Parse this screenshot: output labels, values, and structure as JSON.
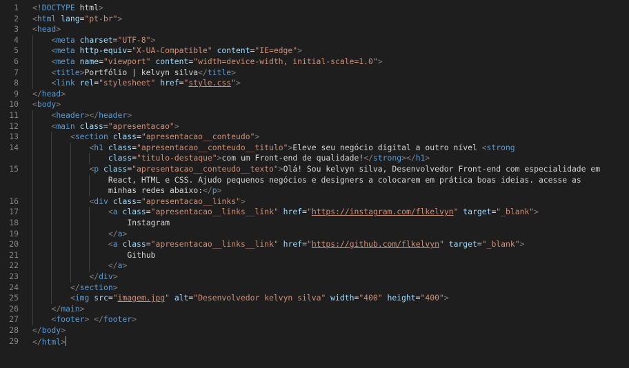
{
  "colors": {
    "background": "#1e1e1e",
    "tag": "#569cd6",
    "bracket": "#808080",
    "attribute": "#9cdcfe",
    "string": "#ce9178",
    "text": "#d4d4d4",
    "line_number": "#858585"
  },
  "active_line": 32,
  "lines": [
    {
      "n": "1",
      "indent": 0,
      "tokens": [
        [
          "br",
          "<!"
        ],
        [
          "doc",
          "DOCTYPE"
        ],
        [
          "text",
          " html"
        ],
        [
          "br",
          ">"
        ]
      ]
    },
    {
      "n": "2",
      "indent": 0,
      "tokens": [
        [
          "br",
          "<"
        ],
        [
          "tag",
          "html"
        ],
        [
          "text",
          " "
        ],
        [
          "attr",
          "lang"
        ],
        [
          "text",
          "="
        ],
        [
          "str",
          "\"pt-br\""
        ],
        [
          "br",
          ">"
        ]
      ]
    },
    {
      "n": "3",
      "indent": 0,
      "tokens": [
        [
          "br",
          "<"
        ],
        [
          "tag",
          "head"
        ],
        [
          "br",
          ">"
        ]
      ]
    },
    {
      "n": "4",
      "indent": 1,
      "tokens": [
        [
          "br",
          "<"
        ],
        [
          "tag",
          "meta"
        ],
        [
          "text",
          " "
        ],
        [
          "attr",
          "charset"
        ],
        [
          "text",
          "="
        ],
        [
          "str",
          "\"UTF-8\""
        ],
        [
          "br",
          ">"
        ]
      ]
    },
    {
      "n": "5",
      "indent": 1,
      "tokens": [
        [
          "br",
          "<"
        ],
        [
          "tag",
          "meta"
        ],
        [
          "text",
          " "
        ],
        [
          "attr",
          "http-equiv"
        ],
        [
          "text",
          "="
        ],
        [
          "str",
          "\"X-UA-Compatible\""
        ],
        [
          "text",
          " "
        ],
        [
          "attr",
          "content"
        ],
        [
          "text",
          "="
        ],
        [
          "str",
          "\"IE=edge\""
        ],
        [
          "br",
          ">"
        ]
      ]
    },
    {
      "n": "6",
      "indent": 1,
      "tokens": [
        [
          "br",
          "<"
        ],
        [
          "tag",
          "meta"
        ],
        [
          "text",
          " "
        ],
        [
          "attr",
          "name"
        ],
        [
          "text",
          "="
        ],
        [
          "str",
          "\"viewport\""
        ],
        [
          "text",
          " "
        ],
        [
          "attr",
          "content"
        ],
        [
          "text",
          "="
        ],
        [
          "str",
          "\"width=device-width, initial-scale=1.0\""
        ],
        [
          "br",
          ">"
        ]
      ]
    },
    {
      "n": "7",
      "indent": 1,
      "tokens": [
        [
          "br",
          "<"
        ],
        [
          "tag",
          "title"
        ],
        [
          "br",
          ">"
        ],
        [
          "text",
          "Portfólio | kelvyn silva"
        ],
        [
          "br",
          "</"
        ],
        [
          "tag",
          "title"
        ],
        [
          "br",
          ">"
        ]
      ]
    },
    {
      "n": "8",
      "indent": 1,
      "tokens": [
        [
          "br",
          "<"
        ],
        [
          "tag",
          "link"
        ],
        [
          "text",
          " "
        ],
        [
          "attr",
          "rel"
        ],
        [
          "text",
          "="
        ],
        [
          "str",
          "\"stylesheet\""
        ],
        [
          "text",
          " "
        ],
        [
          "attr",
          "href"
        ],
        [
          "text",
          "="
        ],
        [
          "str",
          "\""
        ],
        [
          "stru",
          "style.css"
        ],
        [
          "str",
          "\""
        ],
        [
          "br",
          ">"
        ]
      ]
    },
    {
      "n": "9",
      "indent": 0,
      "tokens": [
        [
          "br",
          "</"
        ],
        [
          "tag",
          "head"
        ],
        [
          "br",
          ">"
        ]
      ]
    },
    {
      "n": "10",
      "indent": 0,
      "tokens": [
        [
          "br",
          "<"
        ],
        [
          "tag",
          "body"
        ],
        [
          "br",
          ">"
        ]
      ]
    },
    {
      "n": "11",
      "indent": 1,
      "tokens": [
        [
          "br",
          "<"
        ],
        [
          "tag",
          "header"
        ],
        [
          "br",
          "></"
        ],
        [
          "tag",
          "header"
        ],
        [
          "br",
          ">"
        ]
      ]
    },
    {
      "n": "12",
      "indent": 1,
      "tokens": [
        [
          "br",
          "<"
        ],
        [
          "tag",
          "main"
        ],
        [
          "text",
          " "
        ],
        [
          "attr",
          "class"
        ],
        [
          "text",
          "="
        ],
        [
          "str",
          "\"apresentacao\""
        ],
        [
          "br",
          ">"
        ]
      ]
    },
    {
      "n": "13",
      "indent": 2,
      "tokens": [
        [
          "br",
          "<"
        ],
        [
          "tag",
          "section"
        ],
        [
          "text",
          " "
        ],
        [
          "attr",
          "class"
        ],
        [
          "text",
          "="
        ],
        [
          "str",
          "\"apresentacao__conteudo\""
        ],
        [
          "br",
          ">"
        ]
      ]
    },
    {
      "n": "14",
      "indent": 3,
      "tokens": [
        [
          "br",
          "<"
        ],
        [
          "tag",
          "h1"
        ],
        [
          "text",
          " "
        ],
        [
          "attr",
          "class"
        ],
        [
          "text",
          "="
        ],
        [
          "str",
          "\"apresentacao__conteudo__titulo\""
        ],
        [
          "br",
          ">"
        ],
        [
          "text",
          "Eleve seu negócio digital a outro nível "
        ],
        [
          "br",
          "<"
        ],
        [
          "tag",
          "strong"
        ]
      ]
    },
    {
      "n": "",
      "indent": 4,
      "tokens": [
        [
          "attr",
          "class"
        ],
        [
          "text",
          "="
        ],
        [
          "str",
          "\"titulo-destaque\""
        ],
        [
          "br",
          ">"
        ],
        [
          "text",
          "com um Front-end de qualidade!"
        ],
        [
          "br",
          "</"
        ],
        [
          "tag",
          "strong"
        ],
        [
          "br",
          "></"
        ],
        [
          "tag",
          "h1"
        ],
        [
          "br",
          ">"
        ]
      ]
    },
    {
      "n": "15",
      "indent": 3,
      "tokens": [
        [
          "br",
          "<"
        ],
        [
          "tag",
          "p"
        ],
        [
          "text",
          " "
        ],
        [
          "attr",
          "class"
        ],
        [
          "text",
          "="
        ],
        [
          "str",
          "\"apresentacao__conteudo__texto\""
        ],
        [
          "br",
          ">"
        ],
        [
          "text",
          "Olá! Sou kelvyn silva, Desenvolvedor Front-end com especialidade em"
        ]
      ]
    },
    {
      "n": "",
      "indent": 4,
      "tokens": [
        [
          "text",
          "React, HTML e CSS. Ajudo pequenos negócios e designers a colocarem em prática boas ideias. acesse as"
        ]
      ]
    },
    {
      "n": "",
      "indent": 4,
      "tokens": [
        [
          "text",
          "minhas redes abaixo:"
        ],
        [
          "br",
          "</"
        ],
        [
          "tag",
          "p"
        ],
        [
          "br",
          ">"
        ]
      ]
    },
    {
      "n": "16",
      "indent": 3,
      "tokens": [
        [
          "br",
          "<"
        ],
        [
          "tag",
          "div"
        ],
        [
          "text",
          " "
        ],
        [
          "attr",
          "class"
        ],
        [
          "text",
          "="
        ],
        [
          "str",
          "\"apresentacao__links\""
        ],
        [
          "br",
          ">"
        ]
      ]
    },
    {
      "n": "17",
      "indent": 4,
      "tokens": [
        [
          "br",
          "<"
        ],
        [
          "tag",
          "a"
        ],
        [
          "text",
          " "
        ],
        [
          "attr",
          "class"
        ],
        [
          "text",
          "="
        ],
        [
          "str",
          "\"apresentacao__links__link\""
        ],
        [
          "text",
          " "
        ],
        [
          "attr",
          "href"
        ],
        [
          "text",
          "="
        ],
        [
          "str",
          "\""
        ],
        [
          "stru",
          "https://instagram.com/flkelvyn"
        ],
        [
          "str",
          "\""
        ],
        [
          "text",
          " "
        ],
        [
          "attr",
          "target"
        ],
        [
          "text",
          "="
        ],
        [
          "str",
          "\"_blank\""
        ],
        [
          "br",
          ">"
        ]
      ]
    },
    {
      "n": "18",
      "indent": 5,
      "tokens": [
        [
          "text",
          "Instagram"
        ]
      ]
    },
    {
      "n": "19",
      "indent": 4,
      "tokens": [
        [
          "br",
          "</"
        ],
        [
          "tag",
          "a"
        ],
        [
          "br",
          ">"
        ]
      ]
    },
    {
      "n": "20",
      "indent": 4,
      "tokens": [
        [
          "br",
          "<"
        ],
        [
          "tag",
          "a"
        ],
        [
          "text",
          " "
        ],
        [
          "attr",
          "class"
        ],
        [
          "text",
          "="
        ],
        [
          "str",
          "\"apresentacao__links__link\""
        ],
        [
          "text",
          " "
        ],
        [
          "attr",
          "href"
        ],
        [
          "text",
          "="
        ],
        [
          "str",
          "\""
        ],
        [
          "stru",
          "https://github.com/flkelvyn"
        ],
        [
          "str",
          "\""
        ],
        [
          "text",
          " "
        ],
        [
          "attr",
          "target"
        ],
        [
          "text",
          "="
        ],
        [
          "str",
          "\"_blank\""
        ],
        [
          "br",
          ">"
        ]
      ]
    },
    {
      "n": "21",
      "indent": 5,
      "tokens": [
        [
          "text",
          "Github"
        ]
      ]
    },
    {
      "n": "22",
      "indent": 4,
      "tokens": [
        [
          "br",
          "</"
        ],
        [
          "tag",
          "a"
        ],
        [
          "br",
          ">"
        ]
      ]
    },
    {
      "n": "23",
      "indent": 3,
      "tokens": [
        [
          "br",
          "</"
        ],
        [
          "tag",
          "div"
        ],
        [
          "br",
          ">"
        ]
      ]
    },
    {
      "n": "24",
      "indent": 2,
      "tokens": [
        [
          "br",
          "</"
        ],
        [
          "tag",
          "section"
        ],
        [
          "br",
          ">"
        ]
      ]
    },
    {
      "n": "25",
      "indent": 2,
      "tokens": [
        [
          "br",
          "<"
        ],
        [
          "tag",
          "img"
        ],
        [
          "text",
          " "
        ],
        [
          "attr",
          "src"
        ],
        [
          "text",
          "="
        ],
        [
          "str",
          "\""
        ],
        [
          "stru",
          "imagem.jpg"
        ],
        [
          "str",
          "\""
        ],
        [
          "text",
          " "
        ],
        [
          "attr",
          "alt"
        ],
        [
          "text",
          "="
        ],
        [
          "str",
          "\"Desenvolvedor kelvyn silva\""
        ],
        [
          "text",
          " "
        ],
        [
          "attr",
          "width"
        ],
        [
          "text",
          "="
        ],
        [
          "str",
          "\"400\""
        ],
        [
          "text",
          " "
        ],
        [
          "attr",
          "height"
        ],
        [
          "text",
          "="
        ],
        [
          "str",
          "\"400\""
        ],
        [
          "br",
          ">"
        ]
      ]
    },
    {
      "n": "26",
      "indent": 1,
      "tokens": [
        [
          "br",
          "</"
        ],
        [
          "tag",
          "main"
        ],
        [
          "br",
          ">"
        ]
      ]
    },
    {
      "n": "27",
      "indent": 1,
      "tokens": [
        [
          "br",
          "<"
        ],
        [
          "tag",
          "footer"
        ],
        [
          "br",
          ">"
        ],
        [
          "text",
          " "
        ],
        [
          "br",
          "</"
        ],
        [
          "tag",
          "footer"
        ],
        [
          "br",
          ">"
        ]
      ]
    },
    {
      "n": "28",
      "indent": 0,
      "tokens": [
        [
          "br",
          "</"
        ],
        [
          "tag",
          "body"
        ],
        [
          "br",
          ">"
        ]
      ]
    },
    {
      "n": "29",
      "indent": 0,
      "tokens": [
        [
          "br",
          "</"
        ],
        [
          "tag",
          "html"
        ],
        [
          "br",
          ">"
        ]
      ],
      "cursor": true
    }
  ]
}
